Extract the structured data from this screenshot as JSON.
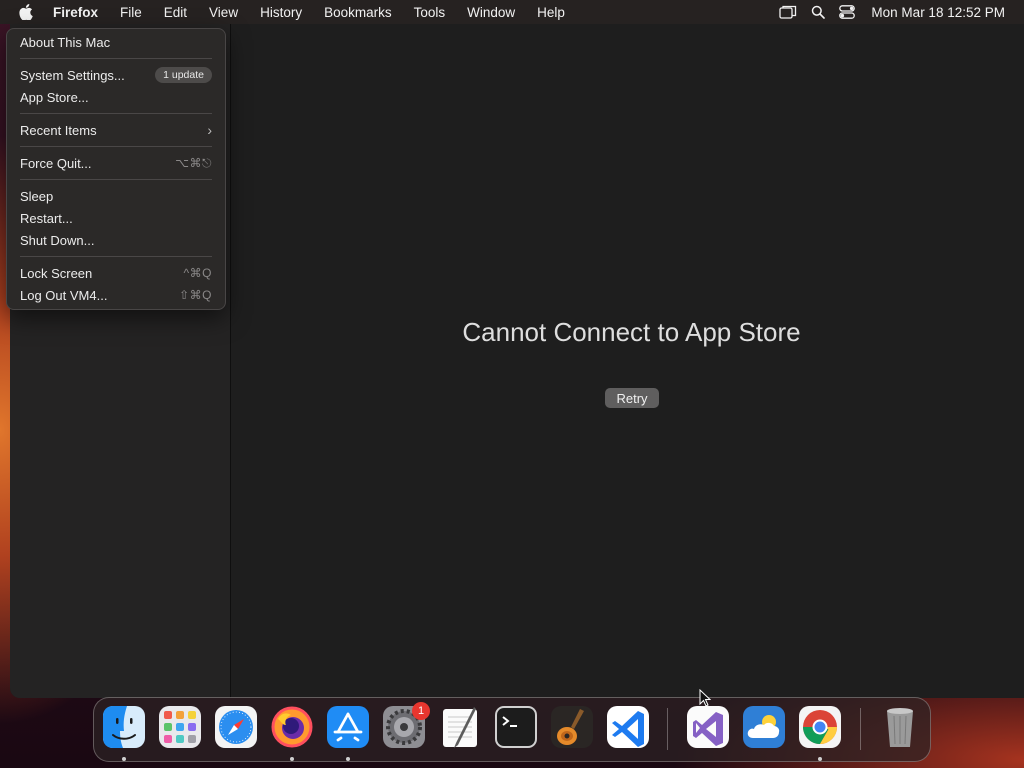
{
  "menubar": {
    "apple_icon": "apple-logo-icon",
    "app_name": "Firefox",
    "items": [
      "File",
      "Edit",
      "View",
      "History",
      "Bookmarks",
      "Tools",
      "Window",
      "Help"
    ],
    "status_icons": [
      "screen-mirroring-icon",
      "search-icon",
      "control-center-icon"
    ],
    "clock": "Mon Mar 18  12:52 PM"
  },
  "apple_menu": {
    "about": "About This Mac",
    "system_settings": "System Settings...",
    "update_badge": "1 update",
    "app_store": "App Store...",
    "recent_items": "Recent Items",
    "force_quit": "Force Quit...",
    "force_quit_shortcut": "⌥⌘⎋",
    "sleep": "Sleep",
    "restart": "Restart...",
    "shut_down": "Shut Down...",
    "lock_screen": "Lock Screen",
    "lock_screen_shortcut": "^⌘Q",
    "log_out": "Log Out VM4...",
    "log_out_shortcut": "⇧⌘Q"
  },
  "window": {
    "message": "Cannot Connect to App Store",
    "retry": "Retry"
  },
  "dock": {
    "apps": [
      "Finder",
      "Launchpad",
      "Safari",
      "Firefox",
      "App Store",
      "System Settings",
      "TextEdit",
      "Terminal",
      "GarageBand",
      "Visual Studio Code",
      "Visual Studio",
      "Weather",
      "Google Chrome",
      "Trash"
    ],
    "system_settings_badge": "1"
  },
  "colors": {
    "menubar": "#262221",
    "window_bg": "#1e1e1e",
    "badge_red": "#e8362f",
    "accent_blue": "#1e7bf0"
  }
}
